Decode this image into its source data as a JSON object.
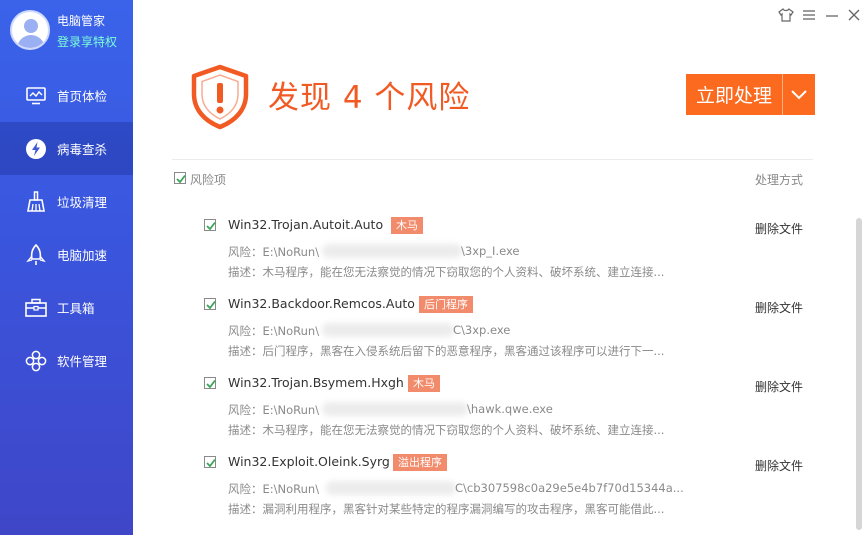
{
  "profile": {
    "name": "电脑管家",
    "link": "登录享特权"
  },
  "nav": [
    {
      "label": "首页体检",
      "icon": "monitor-icon"
    },
    {
      "label": "病毒查杀",
      "icon": "shield-lightning-icon",
      "active": true
    },
    {
      "label": "垃圾清理",
      "icon": "broom-icon"
    },
    {
      "label": "电脑加速",
      "icon": "rocket-icon"
    },
    {
      "label": "工具箱",
      "icon": "toolbox-icon"
    },
    {
      "label": "软件管理",
      "icon": "apps-icon"
    }
  ],
  "window_controls": [
    "shirt-icon",
    "menu-icon",
    "minimize-icon",
    "close-icon"
  ],
  "header": {
    "title": "发现 4 个风险",
    "action_label": "立即处理"
  },
  "table": {
    "select_all_label": "风险项",
    "action_col_label": "处理方式"
  },
  "risks": [
    {
      "name": "Win32.Trojan.Autoit.Auto",
      "tag": "木马",
      "path_prefix": "风险：E:\\NoRun\\",
      "path_suffix": "\\3xp_I.exe",
      "desc": "描述：木马程序，能在您无法察觉的情况下窃取您的个人资料、破坏系统、建立连接...",
      "action": "删除文件"
    },
    {
      "name": "Win32.Backdoor.Remcos.Auto",
      "tag": "后门程序",
      "path_prefix": "风险：E:\\NoRun\\",
      "path_suffix": "C\\3xp.exe",
      "desc": "描述：后门程序，黑客在入侵系统后留下的恶意程序，黑客通过该程序可以进行下一...",
      "action": "删除文件"
    },
    {
      "name": "Win32.Trojan.Bsymem.Hxgh",
      "tag": "木马",
      "path_prefix": "风险：E:\\NoRun\\",
      "path_suffix": "\\hawk.qwe.exe",
      "desc": "描述：木马程序，能在您无法察觉的情况下窃取您的个人资料、破坏系统、建立连接...",
      "action": "删除文件"
    },
    {
      "name": "Win32.Exploit.Oleink.Syrg",
      "tag": "溢出程序",
      "path_prefix": "风险：E:\\NoRun\\",
      "path_suffix": "C\\cb307598c0a29e5e4b7f70d15344a...",
      "desc": "描述：漏洞利用程序，黑客针对某些特定的程序漏洞编写的攻击程序，黑客可能借此...",
      "action": "删除文件"
    }
  ],
  "colors": {
    "sidebar": "#3a55dd",
    "accent": "#f25a24",
    "button": "#fb6a1f",
    "tag": "#f28b6c",
    "check": "#3aa55a"
  }
}
